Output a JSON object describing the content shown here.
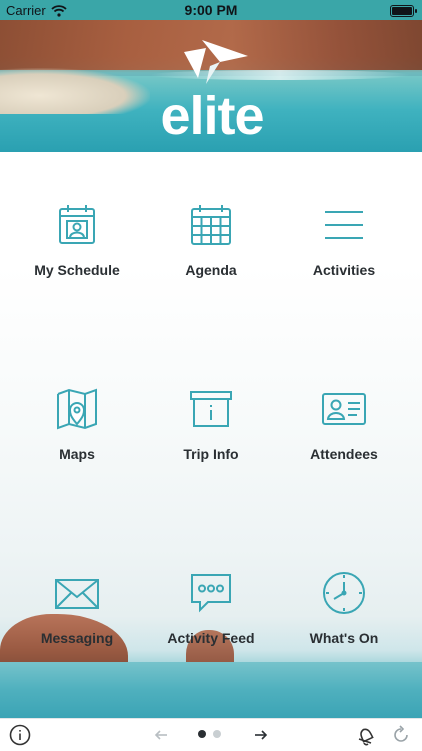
{
  "status_bar": {
    "carrier": "Carrier",
    "time": "9:00 PM"
  },
  "header": {
    "logo_text": "elite"
  },
  "tiles": [
    {
      "label": "My Schedule",
      "icon": "calendar-person-icon"
    },
    {
      "label": "Agenda",
      "icon": "calendar-grid-icon"
    },
    {
      "label": "Activities",
      "icon": "list-lines-icon"
    },
    {
      "label": "Maps",
      "icon": "map-pin-icon"
    },
    {
      "label": "Trip Info",
      "icon": "info-box-icon"
    },
    {
      "label": "Attendees",
      "icon": "id-card-icon"
    },
    {
      "label": "Messaging",
      "icon": "envelope-icon"
    },
    {
      "label": "Activity Feed",
      "icon": "chat-bubble-icon"
    },
    {
      "label": "What's On",
      "icon": "clock-icon"
    }
  ],
  "toolbar": {
    "page_count": 2,
    "current_page": 1
  },
  "colors": {
    "accent": "#3aa6b4",
    "status_bar": "#3aa6a8"
  }
}
